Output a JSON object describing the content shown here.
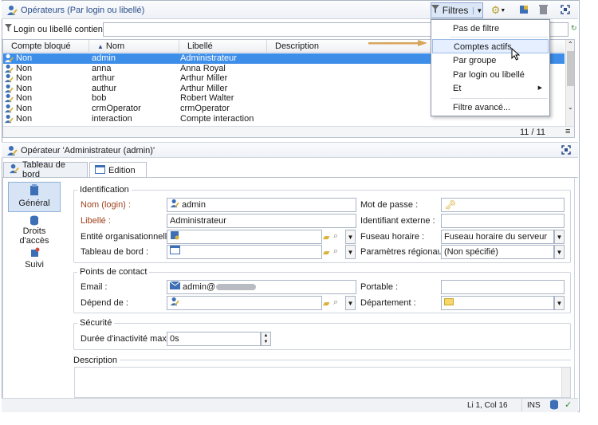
{
  "top_panel": {
    "title": "Opérateurs (Par login ou libellé)",
    "filter_button": "Filtres",
    "filter_label": "Login ou libellé contient :",
    "filter_value": ""
  },
  "grid": {
    "columns": [
      "Compte bloqué",
      "Nom",
      "Libellé",
      "Description"
    ],
    "rows": [
      {
        "blocked": "Non",
        "name": "admin",
        "label": "Administrateur",
        "desc": ""
      },
      {
        "blocked": "Non",
        "name": "anna",
        "label": "Anna Royal",
        "desc": ""
      },
      {
        "blocked": "Non",
        "name": "arthur",
        "label": "Arthur Miller",
        "desc": ""
      },
      {
        "blocked": "Non",
        "name": "authur",
        "label": "Arthur Miller",
        "desc": ""
      },
      {
        "blocked": "Non",
        "name": "bob",
        "label": "Robert Walter",
        "desc": ""
      },
      {
        "blocked": "Non",
        "name": "crmOperator",
        "label": "crmOperator",
        "desc": ""
      },
      {
        "blocked": "Non",
        "name": "interaction",
        "label": "Compte interaction",
        "desc": ""
      }
    ],
    "counter": "11 / 11"
  },
  "filter_menu": {
    "items": [
      "Pas de filtre",
      "Comptes actifs",
      "Par groupe",
      "Par login ou libellé",
      "Et",
      "Filtre avancé..."
    ],
    "highlighted": "Comptes actifs"
  },
  "detail": {
    "title": "Opérateur 'Administrateur (admin)'",
    "tabs": [
      "Tableau de bord",
      "Edition"
    ],
    "active_tab": "Edition",
    "nav": [
      "Général",
      "Droits d'accès",
      "Suivi"
    ],
    "identification": {
      "title": "Identification",
      "login_label": "Nom (login) :",
      "login_value": "admin",
      "libelle_label": "Libellé :",
      "libelle_value": "Administrateur",
      "entity_label": "Entité organisationnelle :",
      "dashboard_label": "Tableau de bord :",
      "password_label": "Mot de passe :",
      "external_id_label": "Identifiant externe :",
      "timezone_label": "Fuseau horaire :",
      "timezone_value": "Fuseau horaire du serveur",
      "regional_label": "Paramètres régionaux :",
      "regional_value": "(Non spécifié)"
    },
    "contact": {
      "title": "Points de contact",
      "email_label": "Email :",
      "email_value": "admin@",
      "depends_label": "Dépend de :",
      "mobile_label": "Portable :",
      "department_label": "Département :"
    },
    "security": {
      "title": "Sécurité",
      "inactivity_label": "Durée d'inactivité max. :",
      "inactivity_value": "0s"
    },
    "description_label": "Description"
  },
  "status": {
    "position": "Li 1, Col 16",
    "mode": "INS"
  },
  "colors": {
    "selection": "#3d8ee8",
    "title_text": "#2c4f8a",
    "arrow": "#d8a55a",
    "required_label": "#a0411c"
  }
}
